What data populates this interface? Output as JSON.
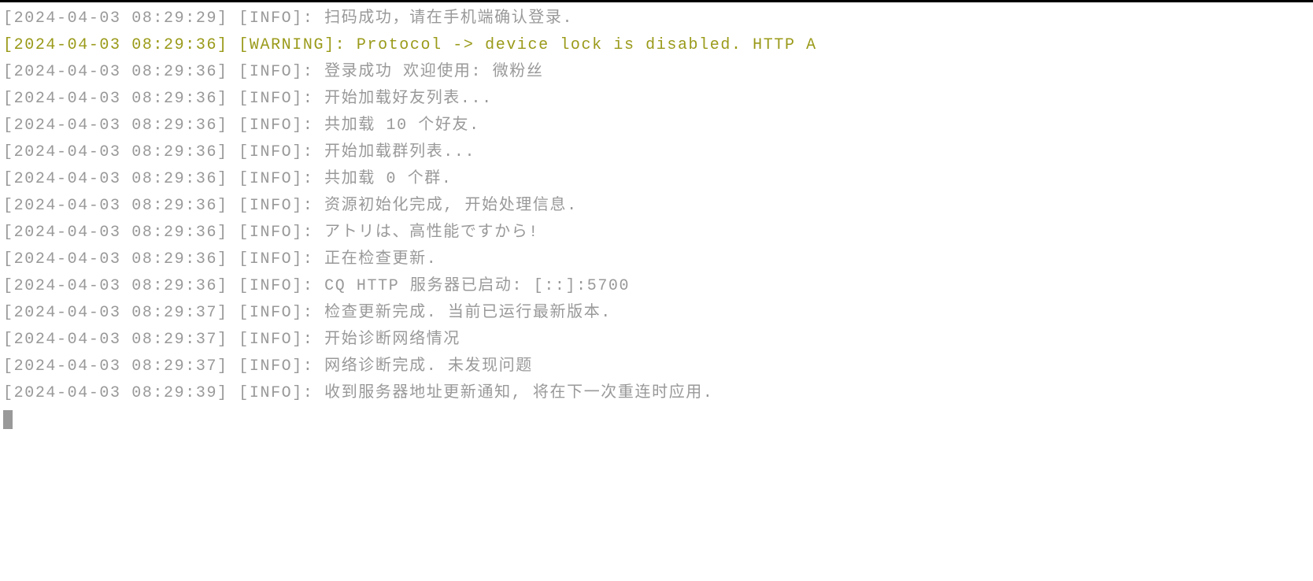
{
  "logs": [
    {
      "timestamp": "2024-04-03 08:29:29",
      "level": "INFO",
      "message": "扫码成功，请在手机端确认登录."
    },
    {
      "timestamp": "2024-04-03 08:29:36",
      "level": "WARNING",
      "message": "Protocol -> device lock is disabled. HTTP A"
    },
    {
      "timestamp": "2024-04-03 08:29:36",
      "level": "INFO",
      "message": "登录成功 欢迎使用: 微粉丝"
    },
    {
      "timestamp": "2024-04-03 08:29:36",
      "level": "INFO",
      "message": "开始加载好友列表..."
    },
    {
      "timestamp": "2024-04-03 08:29:36",
      "level": "INFO",
      "message": "共加载 10 个好友."
    },
    {
      "timestamp": "2024-04-03 08:29:36",
      "level": "INFO",
      "message": "开始加载群列表..."
    },
    {
      "timestamp": "2024-04-03 08:29:36",
      "level": "INFO",
      "message": "共加载 0 个群."
    },
    {
      "timestamp": "2024-04-03 08:29:36",
      "level": "INFO",
      "message": "资源初始化完成, 开始处理信息."
    },
    {
      "timestamp": "2024-04-03 08:29:36",
      "level": "INFO",
      "message": "アトリは、高性能ですから!"
    },
    {
      "timestamp": "2024-04-03 08:29:36",
      "level": "INFO",
      "message": "正在检查更新."
    },
    {
      "timestamp": "2024-04-03 08:29:36",
      "level": "INFO",
      "message": "CQ HTTP 服务器已启动: [::]:5700"
    },
    {
      "timestamp": "2024-04-03 08:29:37",
      "level": "INFO",
      "message": "检查更新完成. 当前已运行最新版本."
    },
    {
      "timestamp": "2024-04-03 08:29:37",
      "level": "INFO",
      "message": "开始诊断网络情况"
    },
    {
      "timestamp": "2024-04-03 08:29:37",
      "level": "INFO",
      "message": "网络诊断完成. 未发现问题"
    },
    {
      "timestamp": "2024-04-03 08:29:39",
      "level": "INFO",
      "message": "收到服务器地址更新通知, 将在下一次重连时应用."
    }
  ]
}
